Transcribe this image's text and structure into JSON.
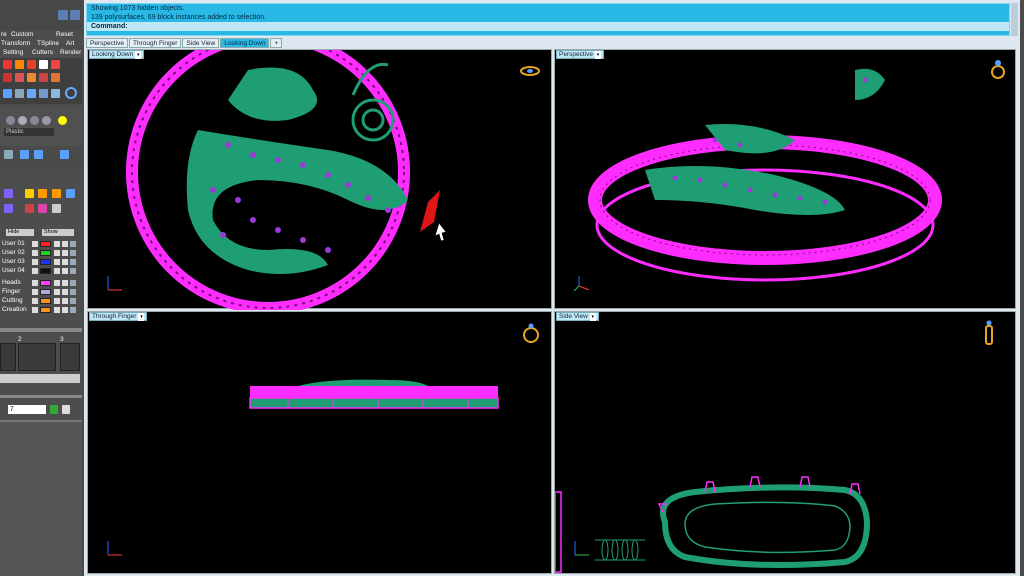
{
  "command": {
    "line1": "Showing 1073 hidden objects.",
    "line2": "139 polysurfaces, 69 block instances added to selection.",
    "prompt": "Command:"
  },
  "tabs": [
    "Perspective",
    "Through Finger",
    "Side View",
    "Looking Down",
    "+"
  ],
  "viewports": {
    "top_left": "Looking Down",
    "top_right": "Perspective",
    "bottom_left": "Through Finger",
    "bottom_right": "Side View"
  },
  "left": {
    "toolbar_row1": [
      "re",
      "Custom",
      "Reset"
    ],
    "toolbar_row2": [
      "Transform",
      "TSpline",
      "Art"
    ],
    "toolbar_row3": [
      "Setting",
      "Cutters",
      "Render"
    ],
    "material_label": "Plastic",
    "hide_label": "Hide",
    "show_label": "Show",
    "layers": [
      {
        "name": "User 01",
        "color": "#ff2020"
      },
      {
        "name": "User 02",
        "color": "#20d020"
      },
      {
        "name": "User 03",
        "color": "#2030ff"
      },
      {
        "name": "User 04",
        "color": "#101010"
      },
      {
        "name": "Heads",
        "color": "#ff40ff"
      },
      {
        "name": "Finger",
        "color": "#b0a8d8"
      },
      {
        "name": "Cutting",
        "color": "#ff9020"
      },
      {
        "name": "Creation",
        "color": "#ff9020"
      }
    ],
    "frame_numbers": [
      "2",
      "3"
    ],
    "spinner_value": "7"
  },
  "colors": {
    "ring": "#ff2cff",
    "dragon": "#1e9e72",
    "gems": "#9b3ad8",
    "accent": "#2ab8e6"
  }
}
